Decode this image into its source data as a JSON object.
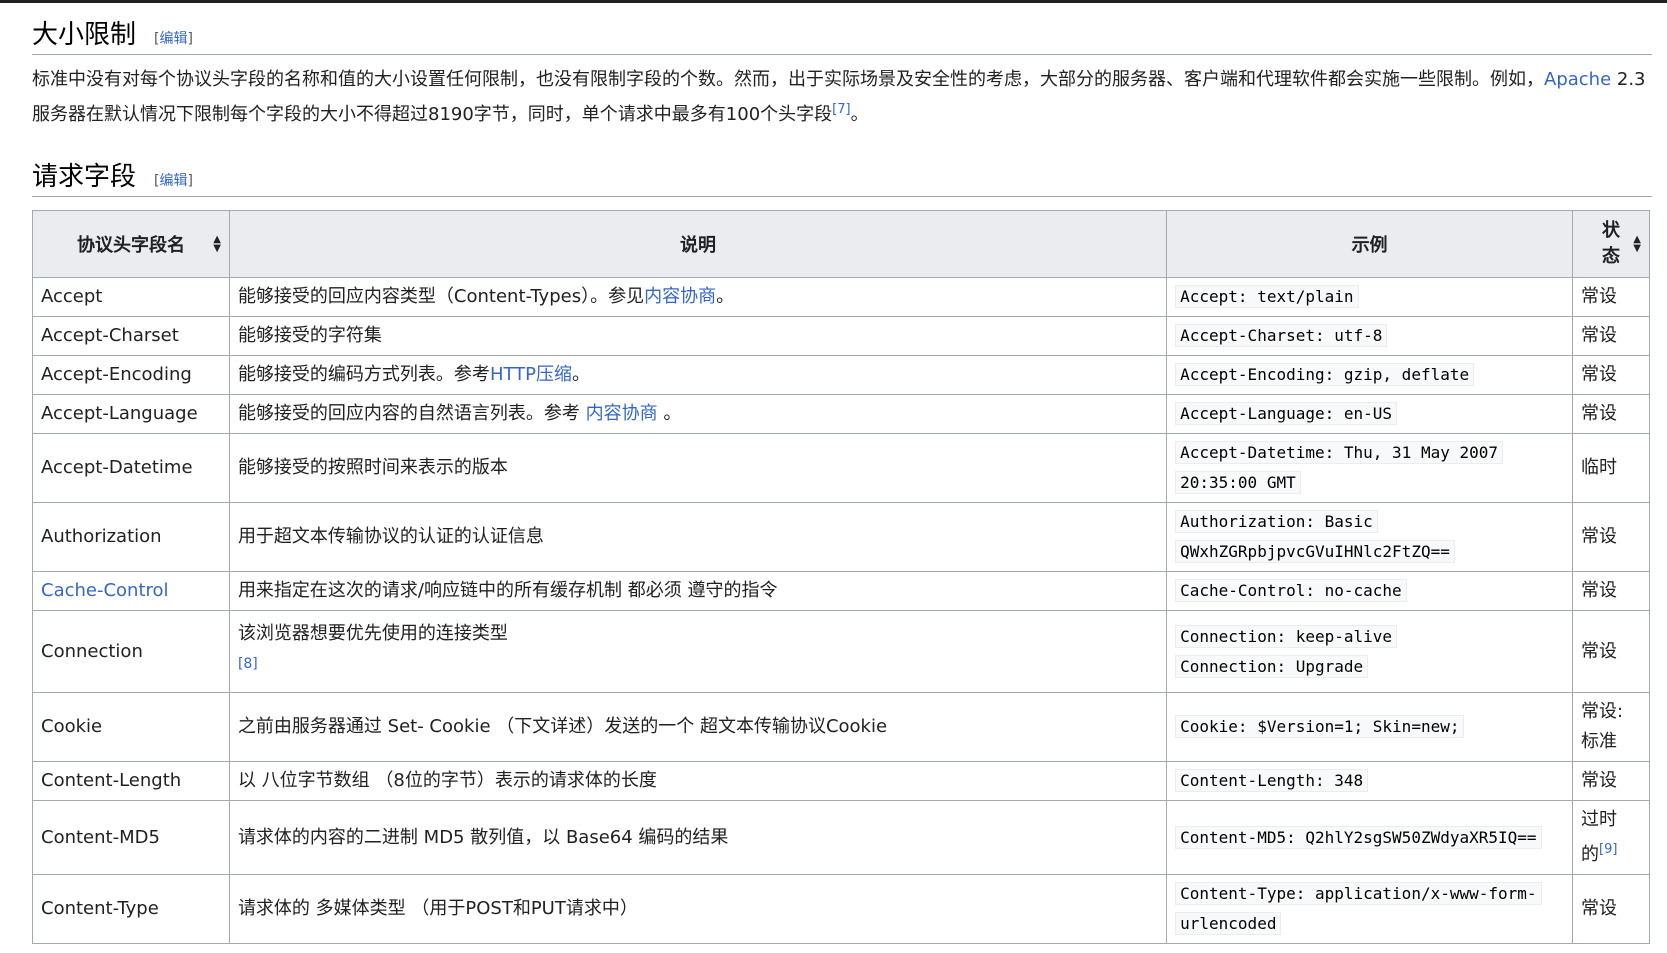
{
  "section1": {
    "title": "大小限制",
    "edit_left": "[",
    "edit_label": "编辑",
    "edit_right": "]",
    "para_part1": "标准中没有对每个协议头字段的名称和值的大小设置任何限制，也没有限制字段的个数。然而，出于实际场景及安全性的考虑，大部分的服务器、客户端和代理软件都会实施一些限制。例如，",
    "para_link": "Apache",
    "para_part2": " 2.3服务器在默认情况下限制每个字段的大小不得超过8190字节，同时，单个请求中最多有100个头字段",
    "para_ref": "[7]",
    "para_end": "。"
  },
  "section2": {
    "title": "请求字段",
    "edit_left": "[",
    "edit_label": "编辑",
    "edit_right": "]"
  },
  "table": {
    "headers": [
      "协议头字段名",
      "说明",
      "示例",
      "状态"
    ],
    "status_header_line1": "状",
    "status_header_line2": "态",
    "rows": [
      {
        "name": "Accept",
        "desc_a": "能够接受的回应内容类型（Content-Types）。参见",
        "desc_link": "内容协商",
        "desc_b": "。",
        "example": "Accept: text/plain",
        "status": "常设"
      },
      {
        "name": "Accept-Charset",
        "desc_a": "能够接受的字符集",
        "example": "Accept-Charset: utf-8",
        "status": "常设"
      },
      {
        "name": "Accept-Encoding",
        "desc_a": "能够接受的编码方式列表。参考",
        "desc_link": "HTTP压缩",
        "desc_b": "。",
        "example": "Accept-Encoding: gzip, deflate",
        "status": "常设"
      },
      {
        "name": "Accept-Language",
        "desc_a": "能够接受的回应内容的自然语言列表。参考 ",
        "desc_link": "内容协商",
        "desc_b": " 。",
        "example": "Accept-Language: en-US",
        "status": "常设"
      },
      {
        "name": "Accept-Datetime",
        "desc_a": "能够接受的按照时间来表示的版本",
        "example_l1": "Accept-Datetime: Thu, 31 May 2007",
        "example_l2": "20:35:00 GMT",
        "status": "临时"
      },
      {
        "name": "Authorization",
        "desc_a": "用于超文本传输协议的认证的认证信息",
        "example_l1": "Authorization: Basic",
        "example_l2": "QWxhZGRpbjpvcGVuIHNlc2FtZQ==",
        "status": "常设"
      },
      {
        "name": "Cache-Control",
        "desc_a": "用来指定在这次的请求/响应链中的所有缓存机制 都必须 遵守的指令",
        "example": "Cache-Control: no-cache",
        "status": "常设"
      },
      {
        "name": "Connection",
        "desc_a": "该浏览器想要优先使用的连接类型",
        "desc_ref": "[8]",
        "example_l1": "Connection: keep-alive",
        "example_l2": "Connection: Upgrade",
        "status": "常设"
      },
      {
        "name": "Cookie",
        "desc_a": "之前由服务器通过 Set- Cookie （下文详述）发送的一个 超文本传输协议Cookie",
        "example": "Cookie: $Version=1; Skin=new;",
        "status_l1": "常设:",
        "status_l2": "标准"
      },
      {
        "name": "Content-Length",
        "desc_a": "以 八位字节数组 （8位的字节）表示的请求体的长度",
        "example": "Content-Length: 348",
        "status": "常设"
      },
      {
        "name": "Content-MD5",
        "desc_a": "请求体的内容的二进制 MD5 散列值，以 Base64 编码的结果",
        "example": "Content-MD5: Q2hlY2sgSW50ZWdyaXR5IQ==",
        "status_l1": "过时",
        "status_l2": "的",
        "status_ref": "[9]"
      },
      {
        "name": "Content-Type",
        "desc_a": "请求体的 多媒体类型 （用于POST和PUT请求中）",
        "example_l1": "Content-Type: application/x-www-form-",
        "example_l2": "urlencoded",
        "status": "常设"
      }
    ]
  }
}
